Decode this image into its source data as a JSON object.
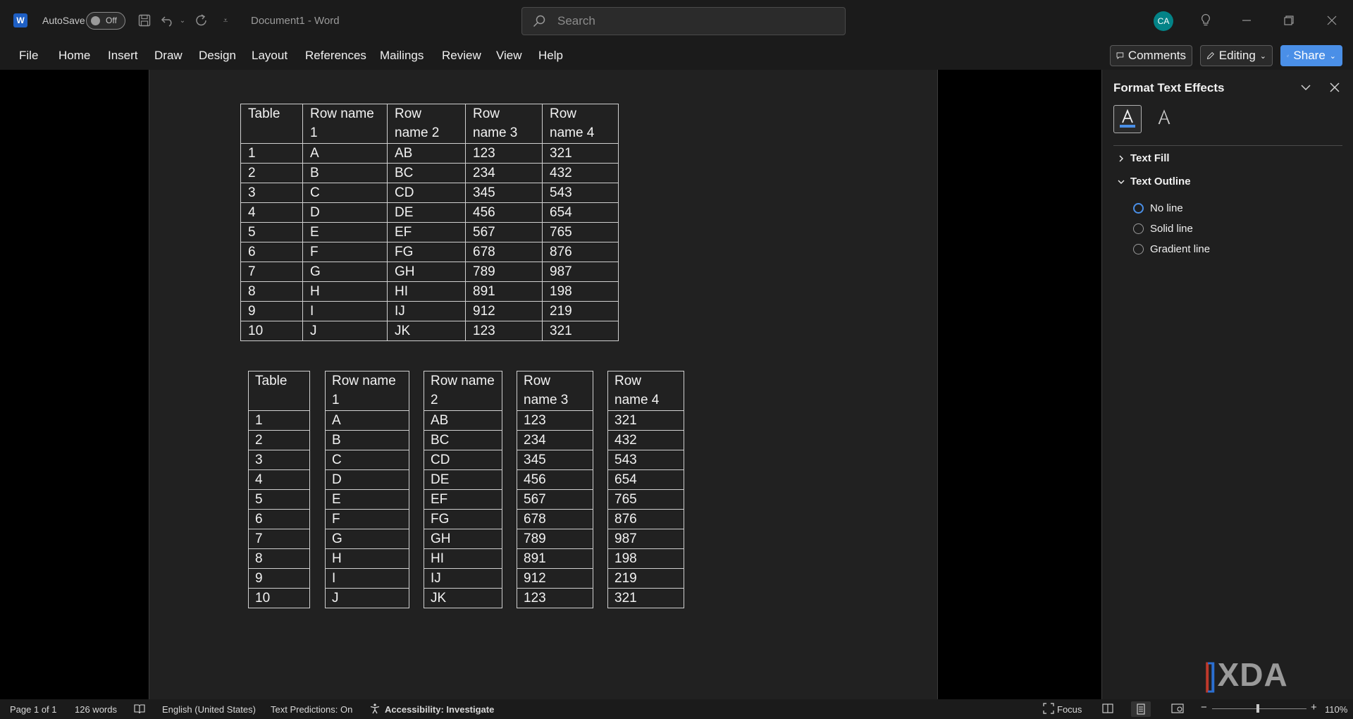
{
  "titlebar": {
    "autosave_label": "AutoSave",
    "autosave_state": "Off",
    "doc_title": "Document1  -  Word",
    "search_placeholder": "Search",
    "avatar_initials": "CA"
  },
  "ribbon": {
    "tabs": [
      "File",
      "Home",
      "Insert",
      "Draw",
      "Design",
      "Layout",
      "References",
      "Mailings",
      "Review",
      "View",
      "Help"
    ],
    "comments_label": "Comments",
    "editing_label": "Editing",
    "share_label": "Share"
  },
  "table_main": {
    "headers": [
      "Table",
      "Row name 1",
      "Row name 2",
      "Row name 3",
      "Row name 4"
    ],
    "rows": [
      [
        "1",
        "A",
        "AB",
        "123",
        "321"
      ],
      [
        "2",
        "B",
        "BC",
        "234",
        "432"
      ],
      [
        "3",
        "C",
        "CD",
        "345",
        "543"
      ],
      [
        "4",
        "D",
        "DE",
        "456",
        "654"
      ],
      [
        "5",
        "E",
        "EF",
        "567",
        "765"
      ],
      [
        "6",
        "F",
        "FG",
        "678",
        "876"
      ],
      [
        "7",
        "G",
        "GH",
        "789",
        "987"
      ],
      [
        "8",
        "H",
        "HI",
        "891",
        "198"
      ],
      [
        "9",
        "I",
        "IJ",
        "912",
        "219"
      ],
      [
        "10",
        "J",
        "JK",
        "123",
        "321"
      ]
    ]
  },
  "pane": {
    "title": "Format Text Effects",
    "section_fill": "Text Fill",
    "section_outline": "Text Outline",
    "options": [
      "No line",
      "Solid line",
      "Gradient line"
    ],
    "selected_option": "No line"
  },
  "watermark": "XDA",
  "status": {
    "page": "Page 1 of 1",
    "words": "126 words",
    "language": "English (United States)",
    "predictions": "Text Predictions: On",
    "accessibility": "Accessibility: Investigate",
    "focus": "Focus",
    "zoom": "110%"
  },
  "colors": {
    "accent": "#4a8fe7",
    "avatar": "#038387",
    "word_brand": "#1e5fc4"
  }
}
